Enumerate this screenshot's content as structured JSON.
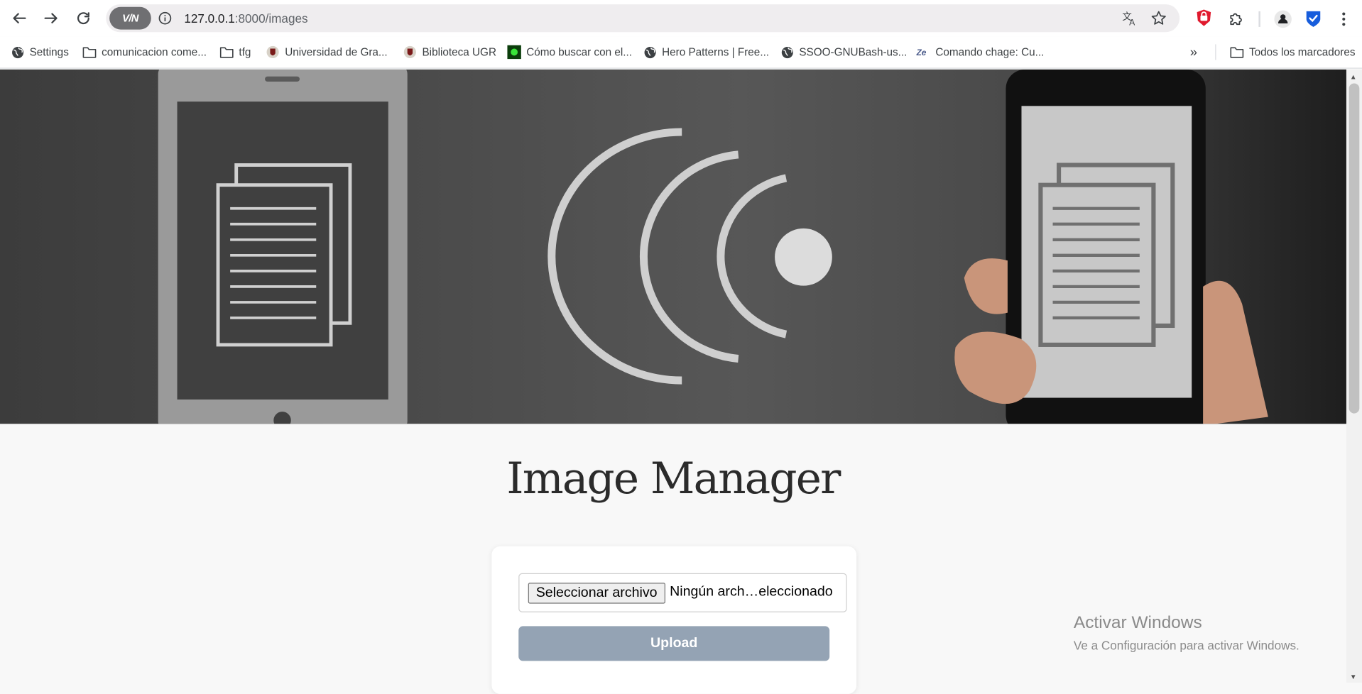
{
  "browser": {
    "url_host": "127.0.0.1",
    "url_path": ":8000/images",
    "vpn_label": "V/N"
  },
  "bookmarks": {
    "items": [
      {
        "label": "Settings",
        "icon": "globe-icon"
      },
      {
        "label": "comunicacion come...",
        "icon": "folder-icon"
      },
      {
        "label": "tfg",
        "icon": "folder-icon"
      },
      {
        "label": "Universidad de Gra...",
        "icon": "crest-icon"
      },
      {
        "label": "Biblioteca UGR",
        "icon": "crest-icon"
      },
      {
        "label": "Cómo buscar con el...",
        "icon": "green-square-icon"
      },
      {
        "label": "Hero Patterns | Free...",
        "icon": "globe-icon"
      },
      {
        "label": "SSOO-GNUBash-us...",
        "icon": "globe-icon"
      },
      {
        "label": "Comando chage: Cu...",
        "icon": "ze-icon"
      }
    ],
    "overflow": "»",
    "all_bookmarks": "Todos los marcadores"
  },
  "page": {
    "title": "Image Manager",
    "file_button": "Seleccionar archivo",
    "file_status": "Ningún arch…eleccionado",
    "upload_label": "Upload"
  },
  "watermark": {
    "title": "Activar Windows",
    "subtitle": "Ve a Configuración para activar Windows."
  },
  "colors": {
    "upload_button": "#94a3b4",
    "page_background": "#f8f8f8",
    "brave_shield": "#e0192d",
    "bitwarden": "#175ddc"
  }
}
